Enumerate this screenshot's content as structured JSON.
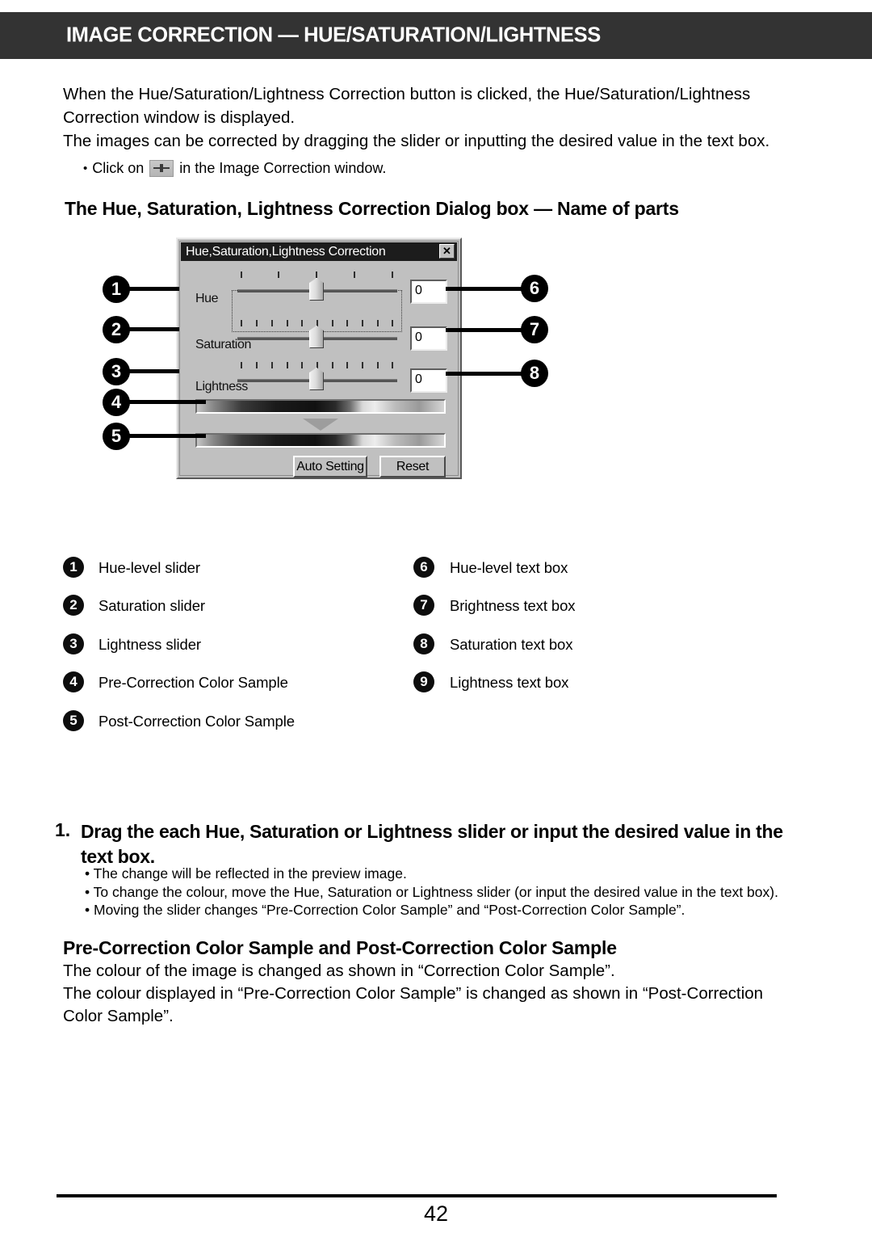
{
  "header": {
    "title": "IMAGE CORRECTION — HUE/SATURATION/LIGHTNESS"
  },
  "intro": {
    "line1": "When the Hue/Saturation/Lightness Correction button is clicked, the Hue/Saturation/Lightness",
    "line2": "Correction window is displayed.",
    "line3": "The images can be corrected by dragging the slider or inputting the desired value in the text box.",
    "bullet_dot": "•",
    "bullet_before": "Click on",
    "bullet_icon": "image-correction-button-icon",
    "bullet_after": "in the Image Correction window."
  },
  "headings": {
    "name_of_parts": "The Hue, Saturation, Lightness Correction Dialog box — Name of parts",
    "color_sample": "Pre-Correction Color Sample and Post-Correction Color Sample"
  },
  "dialog": {
    "title": "Hue,Saturation,Lightness Correction",
    "close_label": "✕",
    "rows": [
      {
        "label": "Hue",
        "value": "0"
      },
      {
        "label": "Saturation",
        "value": "0"
      },
      {
        "label": "Lightness",
        "value": "0"
      }
    ],
    "buttons": {
      "auto_setting": "Auto Setting",
      "reset": "Reset"
    }
  },
  "callouts": {
    "left": [
      "1",
      "2",
      "3",
      "4",
      "5"
    ],
    "right": [
      "6",
      "7",
      "8"
    ]
  },
  "legend": {
    "left": [
      {
        "num": "1",
        "label": "Hue-level slider"
      },
      {
        "num": "2",
        "label": "Saturation slider"
      },
      {
        "num": "3",
        "label": "Lightness slider"
      },
      {
        "num": "4",
        "label": "Pre-Correction Color Sample"
      },
      {
        "num": "5",
        "label": "Post-Correction Color Sample"
      }
    ],
    "right": [
      {
        "num": "6",
        "label": "Hue-level text box"
      },
      {
        "num": "7",
        "label": "Brightness text box"
      },
      {
        "num": "8",
        "label": "Saturation text box"
      },
      {
        "num": "9",
        "label": "Lightness text box"
      }
    ]
  },
  "step": {
    "number": "1.",
    "text": "Drag the each Hue, Saturation or Lightness slider or input the desired value in the text box.",
    "bullets": [
      "• The change will be reflected in the preview image.",
      "• To change the colour, move the Hue, Saturation or Lightness slider (or input the desired value in the text box).",
      "• Moving the slider changes “Pre-Correction Color Sample” and “Post-Correction Color Sample”."
    ]
  },
  "color_sample_body": {
    "line1": "The colour of the image is changed as shown in “Correction Color Sample”.",
    "line2": "The colour displayed in “Pre-Correction Color Sample” is changed as shown in “Post-Correction",
    "line3": "Color Sample”."
  },
  "footer": {
    "page_number": "42"
  }
}
